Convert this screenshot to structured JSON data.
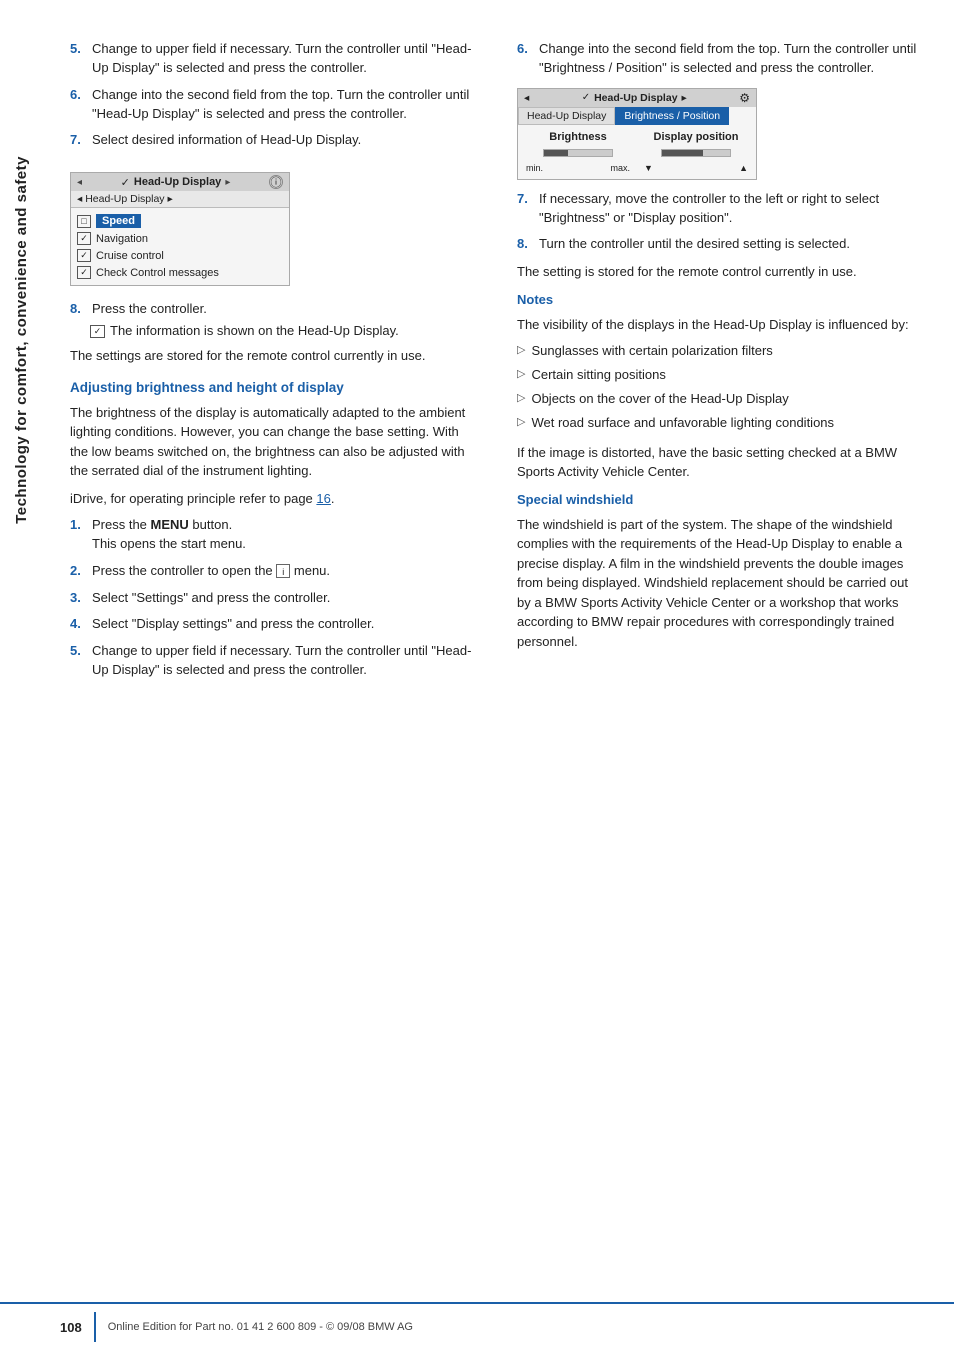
{
  "sidebar": {
    "text": "Technology for comfort, convenience and safety"
  },
  "left_col": {
    "steps_top": [
      {
        "number": "5.",
        "text": "Change to upper field if necessary. Turn the controller until \"Head-Up Display\" is selected and press the controller."
      },
      {
        "number": "6.",
        "text": "Change into the second field from the top. Turn the controller until \"Head-Up Display\" is selected and press the controller."
      },
      {
        "number": "7.",
        "text": "Select desired information of Head-Up Display."
      }
    ],
    "hud_mockup": {
      "top_bar_label": "Head-Up Display",
      "arrow_left": "◂",
      "arrow_right": "▸",
      "second_row_label": "◂ Head-Up Display ▸",
      "items": [
        {
          "icon": "□",
          "label": "Speed",
          "highlight": true
        },
        {
          "icon": "✓",
          "label": "Navigation"
        },
        {
          "icon": "✓",
          "label": "Cruise control"
        },
        {
          "icon": "✓",
          "label": "Check Control messages"
        }
      ]
    },
    "step8": {
      "number": "8.",
      "text": "Press the controller."
    },
    "step8_note": "The information is shown on the Head-Up Display.",
    "para1": "The settings are stored for the remote control currently in use.",
    "section_heading": "Adjusting brightness and height of display",
    "para2": "The brightness of the display is automatically adapted to the ambient lighting conditions. However, you can change the base setting. With the low beams switched on, the brightness can also be adjusted with the serrated dial of the instrument lighting.",
    "idrive_ref": "iDrive, for operating principle refer to page 16.",
    "steps_bottom": [
      {
        "number": "1.",
        "text": "Press the MENU button.\nThis opens the start menu.",
        "bold_part": "MENU"
      },
      {
        "number": "2.",
        "text": "Press the controller to open the i menu."
      },
      {
        "number": "3.",
        "text": "Select \"Settings\" and press the controller."
      },
      {
        "number": "4.",
        "text": "Select \"Display settings\" and press the controller."
      },
      {
        "number": "5.",
        "text": "Change to upper field if necessary. Turn the controller until \"Head-Up Display\" is selected and press the controller."
      }
    ]
  },
  "right_col": {
    "step6": {
      "number": "6.",
      "text": "Change into the second field from the top. Turn the controller until \"Brightness / Position\" is selected and press the controller."
    },
    "hud_mockup2": {
      "top_label": "Head-Up Display",
      "tab1": "Head-Up Display",
      "tab2": "Brightness / Position",
      "col1_title": "Brightness",
      "col2_title": "Display position",
      "col1_min": "min.",
      "col1_max": "max."
    },
    "step7": {
      "number": "7.",
      "text": "If necessary, move the controller to the left or right to select \"Brightness\" or \"Display position\"."
    },
    "step8": {
      "number": "8.",
      "text": "Turn the controller until the desired setting is selected."
    },
    "para1": "The setting is stored for the remote control currently in use.",
    "notes_heading": "Notes",
    "notes_intro": "The visibility of the displays in the Head-Up Display is influenced by:",
    "bullets": [
      "Sunglasses with certain polarization filters",
      "Certain sitting positions",
      "Objects on the cover of the Head-Up Display",
      "Wet road surface and unfavorable lighting conditions"
    ],
    "notes_para": "If the image is distorted, have the basic setting checked at a BMW Sports Activity Vehicle Center.",
    "special_heading": "Special windshield",
    "special_para": "The windshield is part of the system. The shape of the windshield complies with the requirements of the Head-Up Display to enable a precise display. A film in the windshield prevents the double images from being displayed. Windshield replacement should be carried out by a BMW Sports Activity Vehicle Center or a workshop that works according to BMW repair procedures with correspondingly trained personnel."
  },
  "footer": {
    "page_number": "108",
    "text": "Online Edition for Part no. 01 41 2 600 809 - © 09/08 BMW AG"
  }
}
